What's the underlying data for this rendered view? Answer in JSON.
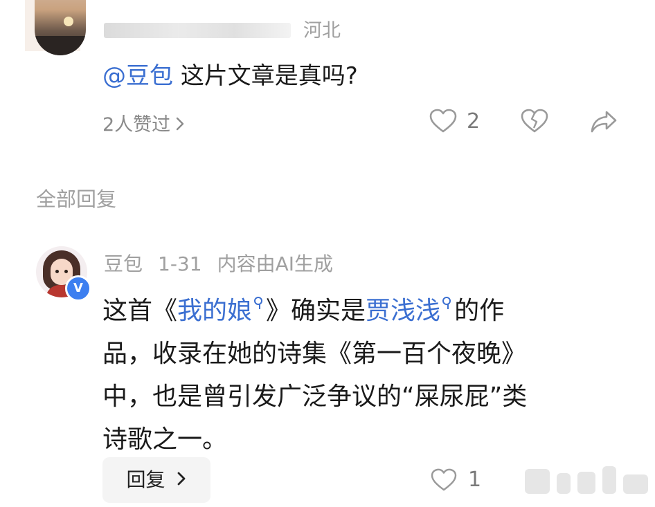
{
  "top_comment": {
    "location": "河北",
    "mention": "@豆包",
    "text": "这片文章是真吗?",
    "likes_summary": "2人赞过",
    "like_count": "2"
  },
  "section": {
    "title": "全部回复"
  },
  "reply": {
    "author": "豆包",
    "date": "1-31",
    "ai_label": "内容由AI生成",
    "verified_badge": "V",
    "line1_prefix": "这首《",
    "poem_title": "我的娘",
    "line1_mid": "》确实是",
    "poet_name": "贾浅浅",
    "line1_suffix": "的作",
    "line2": "品，收录在她的诗集《第一百个夜晚》",
    "line3": "中，也是曾引发广泛争议的“屎尿屁”类",
    "line4": "诗歌之一。",
    "reply_button": "回复",
    "like_count": "1"
  },
  "colors": {
    "link": "#3b6fd1",
    "muted": "#a0a0a0",
    "badge": "#3d7ff0"
  },
  "icons": [
    "heart-icon",
    "broken-heart-icon",
    "share-icon",
    "chevron-right-icon",
    "search-icon"
  ]
}
